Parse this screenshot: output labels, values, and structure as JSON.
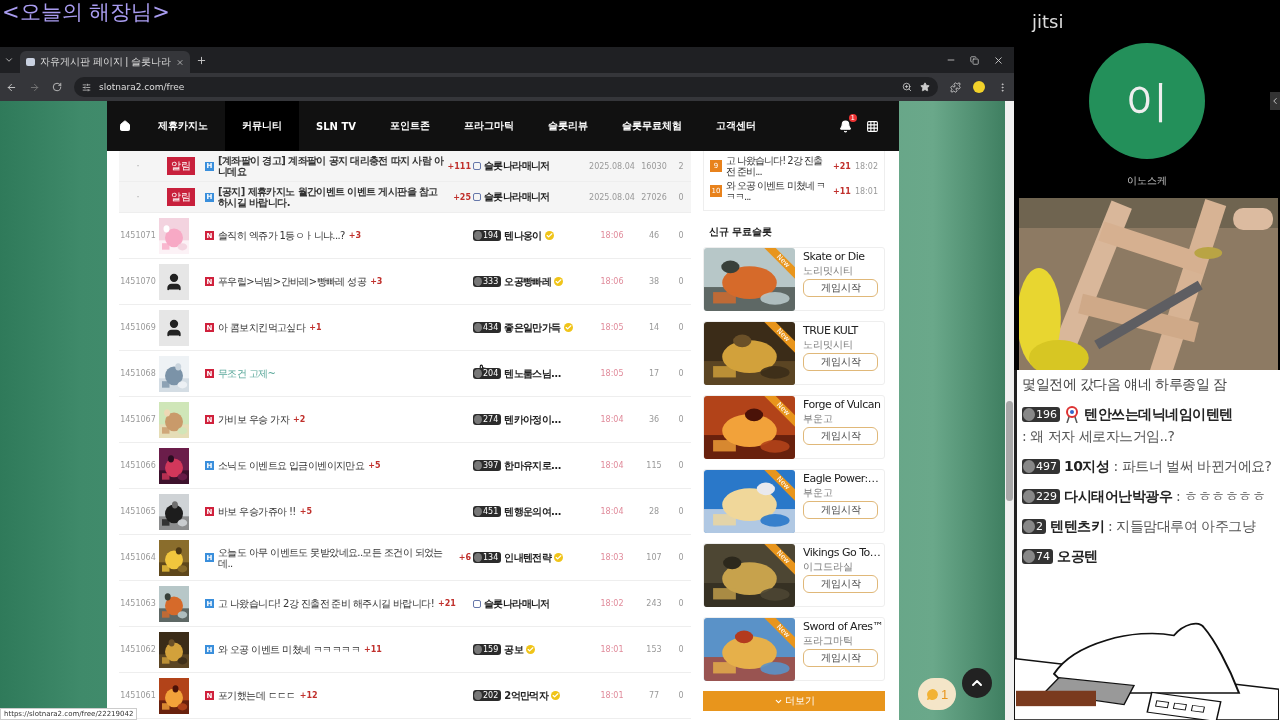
{
  "overlay_title": "<오늘의 해장님>",
  "browser": {
    "tabs": [
      {
        "title": "자유게시판 페이지 | 슬롯나라",
        "selected": true
      }
    ],
    "url": "slotnara2.com/free",
    "status_url": "https://slotnara2.com/free/22219042"
  },
  "nav": {
    "items": [
      {
        "label": "제휴카지노",
        "selected": false
      },
      {
        "label": "커뮤니티",
        "selected": true
      },
      {
        "label": "SLN TV",
        "selected": false
      },
      {
        "label": "포인트존",
        "selected": false
      },
      {
        "label": "프라그마틱",
        "selected": false
      },
      {
        "label": "슬롯리뷰",
        "selected": false
      },
      {
        "label": "슬롯무료체험",
        "selected": false
      },
      {
        "label": "고객센터",
        "selected": false
      }
    ],
    "notification_count": "1"
  },
  "notices": [
    {
      "dot": "·",
      "tag": "알림",
      "mark": {
        "kind": "hot",
        "label": "H"
      },
      "title": "[계좌팔이 경고] 계좌팔이 공지 대리충전 따지 사람 아니데요",
      "comments": "+111",
      "author": "슬롯나라매니저",
      "date": "2025.08.04",
      "views": "16030",
      "likes": "2"
    },
    {
      "dot": "·",
      "tag": "알림",
      "mark": {
        "kind": "hot",
        "label": "H"
      },
      "title": "[공지] 제휴카지노 월간이벤트 이벤트 게시판을 참고 하시길 바랍니다.",
      "comments": "+25",
      "author": "슬롯나라매니저",
      "date": "2025.08.04",
      "views": "27026",
      "likes": "0"
    }
  ],
  "posts": [
    {
      "id": "1451071",
      "mark": {
        "kind": "new",
        "label": "N"
      },
      "title": "솔직히 엑쥬가 1등ㅇㅏ니냐...?",
      "comments": "+3",
      "author": {
        "kind": "member",
        "level": "194",
        "name": "텐나옹이"
      },
      "verified": true,
      "time": "18:06",
      "views": "46",
      "likes": "0",
      "hovered": false
    },
    {
      "id": "1451070",
      "avatar": {
        "kind": "silhouette"
      },
      "mark": {
        "kind": "new",
        "label": "N"
      },
      "title": "푸우릴>닉빔>간바레>빵빠레 성공",
      "comments": "+3",
      "author": {
        "kind": "member",
        "level": "333",
        "name": "오공빵빠레"
      },
      "verified": true,
      "time": "18:06",
      "views": "38",
      "likes": "0",
      "hovered": false
    },
    {
      "id": "1451069",
      "avatar": {
        "kind": "silhouette"
      },
      "mark": {
        "kind": "new",
        "label": "N"
      },
      "title": "아 콤보치킨먹고싶다",
      "comments": "+1",
      "author": {
        "kind": "member",
        "level": "434",
        "name": "좋은일만가득"
      },
      "verified": true,
      "time": "18:05",
      "views": "14",
      "likes": "0",
      "hovered": false
    },
    {
      "id": "1451068",
      "mark": {
        "kind": "new",
        "label": "N"
      },
      "title": "무조건 고제~",
      "author": {
        "kind": "member",
        "level": "204",
        "name": "텐노룸스님…"
      },
      "verified": false,
      "time": "18:05",
      "views": "17",
      "likes": "0",
      "hovered": true
    },
    {
      "id": "1451067",
      "mark": {
        "kind": "new",
        "label": "N"
      },
      "title": "가비보 우승 가자",
      "comments": "+2",
      "author": {
        "kind": "member",
        "level": "274",
        "name": "텐카아정이…"
      },
      "verified": false,
      "time": "18:04",
      "views": "36",
      "likes": "0",
      "hovered": false
    },
    {
      "id": "1451066",
      "mark": {
        "kind": "hot",
        "label": "H"
      },
      "title": "소닉도 이벤트요 입금이벤이지만요",
      "comments": "+5",
      "author": {
        "kind": "member",
        "level": "397",
        "name": "한마유지로…"
      },
      "verified": false,
      "time": "18:04",
      "views": "115",
      "likes": "0",
      "hovered": false
    },
    {
      "id": "1451065",
      "mark": {
        "kind": "new",
        "label": "N"
      },
      "title": "바보 우승가쥬아 !!",
      "comments": "+5",
      "author": {
        "kind": "member",
        "level": "451",
        "name": "텐행운의여…"
      },
      "verified": false,
      "time": "18:04",
      "views": "28",
      "likes": "0",
      "hovered": false
    },
    {
      "id": "1451064",
      "mark": {
        "kind": "hot",
        "label": "H"
      },
      "title": "오늘도 아무 이벤트도 못받았네요..모든 조건이 되었는데..",
      "comments": "+6",
      "author": {
        "kind": "member",
        "level": "134",
        "name": "인내텐전략"
      },
      "verified": true,
      "time": "18:03",
      "views": "107",
      "likes": "0",
      "hovered": false
    },
    {
      "id": "1451063",
      "mark": {
        "kind": "hot",
        "label": "H"
      },
      "title": "고 나왔습니다! 2강 진출전 준비 해주시길 바랍니다!",
      "comments": "+21",
      "author": {
        "kind": "manager",
        "name": "슬롯나라매니저"
      },
      "verified": false,
      "time": "18:02",
      "views": "243",
      "likes": "0",
      "hovered": false
    },
    {
      "id": "1451062",
      "mark": {
        "kind": "hot",
        "label": "H"
      },
      "title": "와 오공 이벤트 미쳤네 ㅋㅋㅋㅋㅋ",
      "comments": "+11",
      "author": {
        "kind": "member",
        "level": "159",
        "name": "공보"
      },
      "verified": true,
      "time": "18:01",
      "views": "153",
      "likes": "0",
      "hovered": false
    },
    {
      "id": "1451061",
      "mark": {
        "kind": "new",
        "label": "N"
      },
      "title": "포기했는데 ㄷㄷㄷ",
      "comments": "+12",
      "author": {
        "kind": "member",
        "level": "202",
        "name": "2억만먹자"
      },
      "verified": true,
      "time": "18:01",
      "views": "77",
      "likes": "0",
      "hovered": false
    }
  ],
  "popular": [
    {
      "rank": "9",
      "title": "고 나왔습니다! 2강 진출전 준비...",
      "comments": "+21",
      "time": "18:02"
    },
    {
      "rank": "10",
      "title": "와 오공 이벤트 미쳤네 ㅋㅋㅋ...",
      "comments": "+11",
      "time": "18:01"
    }
  ],
  "free_slots": {
    "heading": "신규 무료슬롯",
    "games": [
      {
        "title": "Skate or Die",
        "provider": "노리밋시티",
        "ribbon": "New",
        "button": "게임시작"
      },
      {
        "title": "TRUE KULT",
        "provider": "노리밋시티",
        "ribbon": "New",
        "button": "게임시작"
      },
      {
        "title": "Forge of Vulcan",
        "provider": "부운고",
        "ribbon": "New",
        "button": "게임시작"
      },
      {
        "title": "Eagle Power:…",
        "provider": "부운고",
        "ribbon": "New",
        "button": "게임시작"
      },
      {
        "title": "Vikings Go To…",
        "provider": "이그드라실",
        "ribbon": "New",
        "button": "게임시작"
      },
      {
        "title": "Sword of Ares™",
        "provider": "프라그마틱",
        "ribbon": "New",
        "button": "게임시작"
      }
    ],
    "more": "더보기"
  },
  "floating": {
    "chat_count": "1"
  },
  "jitsi": {
    "logo": "jitsi",
    "avatar_letter": "이",
    "name": "이노스케"
  },
  "chat": [
    {
      "kind": "text",
      "text": "몇일전에 갔다옴 얘네 하루종일 잠"
    },
    {
      "kind": "message",
      "level": "196",
      "emblem": true,
      "user": "텐안쓰는데닉네임이텐텐",
      "text": ": 왜 저자 세로자느거임..?"
    },
    {
      "kind": "message",
      "level": "497",
      "emblem": false,
      "user": "10지성",
      "text": ": 파트너 벌써 바뀐거에요?"
    },
    {
      "kind": "message",
      "level": "229",
      "emblem": false,
      "user": "다시태어난박광우",
      "text": ": ㅎㅎㅎㅎㅎㅎ"
    },
    {
      "kind": "message",
      "level": "2",
      "emblem": false,
      "user": "텐텐츠키",
      "text": ": 지들맘대루여 아주그냥"
    },
    {
      "kind": "message",
      "level": "74",
      "emblem": false,
      "user": "오공텐"
    }
  ]
}
